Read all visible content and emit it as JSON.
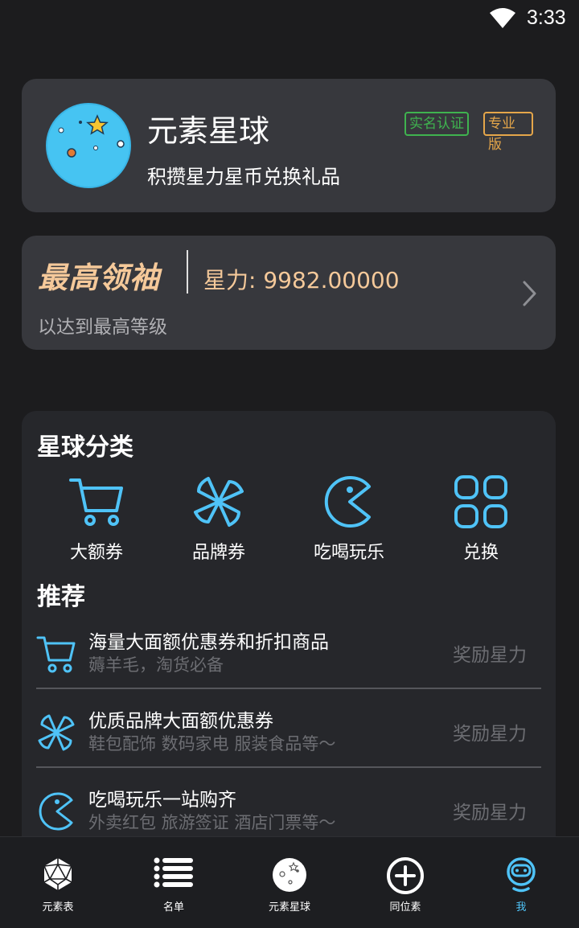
{
  "status_bar": {
    "time": "3:33"
  },
  "profile": {
    "name": "元素星球",
    "subtitle": "积攒星力星币兑换礼品",
    "badges": [
      "实名认证",
      "专业版"
    ]
  },
  "level": {
    "name": "最高领袖",
    "points_label": "星力: 9982.00000",
    "description": "以达到最高等级"
  },
  "categories": {
    "title": "星球分类",
    "items": [
      {
        "label": "大额券",
        "icon": "cart-icon"
      },
      {
        "label": "品牌券",
        "icon": "pinwheel-icon"
      },
      {
        "label": "吃喝玩乐",
        "icon": "pacman-icon"
      },
      {
        "label": "兑换",
        "icon": "grid-icon"
      }
    ]
  },
  "recommend": {
    "title": "推荐",
    "items": [
      {
        "title": "海量大面额优惠券和折扣商品",
        "subtitle": "薅羊毛，淘货必备",
        "reward": "奖励星力",
        "icon": "cart-icon"
      },
      {
        "title": "优质品牌大面额优惠券",
        "subtitle": "鞋包配饰 数码家电 服装食品等～",
        "reward": "奖励星力",
        "icon": "pinwheel-icon"
      },
      {
        "title": "吃喝玩乐一站购齐",
        "subtitle": "外卖红包 旅游签证 酒店门票等～",
        "reward": "奖励星力",
        "icon": "pacman-icon"
      }
    ]
  },
  "bottom_nav": {
    "items": [
      {
        "label": "元素表",
        "icon": "d20-icon"
      },
      {
        "label": "名单",
        "icon": "list-icon"
      },
      {
        "label": "元素星球",
        "icon": "moon-icon"
      },
      {
        "label": "同位素",
        "icon": "plus-circle-icon"
      },
      {
        "label": "我",
        "icon": "robot-icon"
      }
    ],
    "active": "我"
  },
  "colors": {
    "background": "#1c1c1e",
    "card": "#37383d",
    "accent_cyan": "#4fc3f7",
    "gold": "#f5c99a",
    "verified_green": "#3fb34f",
    "pro_orange": "#e5a64a"
  }
}
